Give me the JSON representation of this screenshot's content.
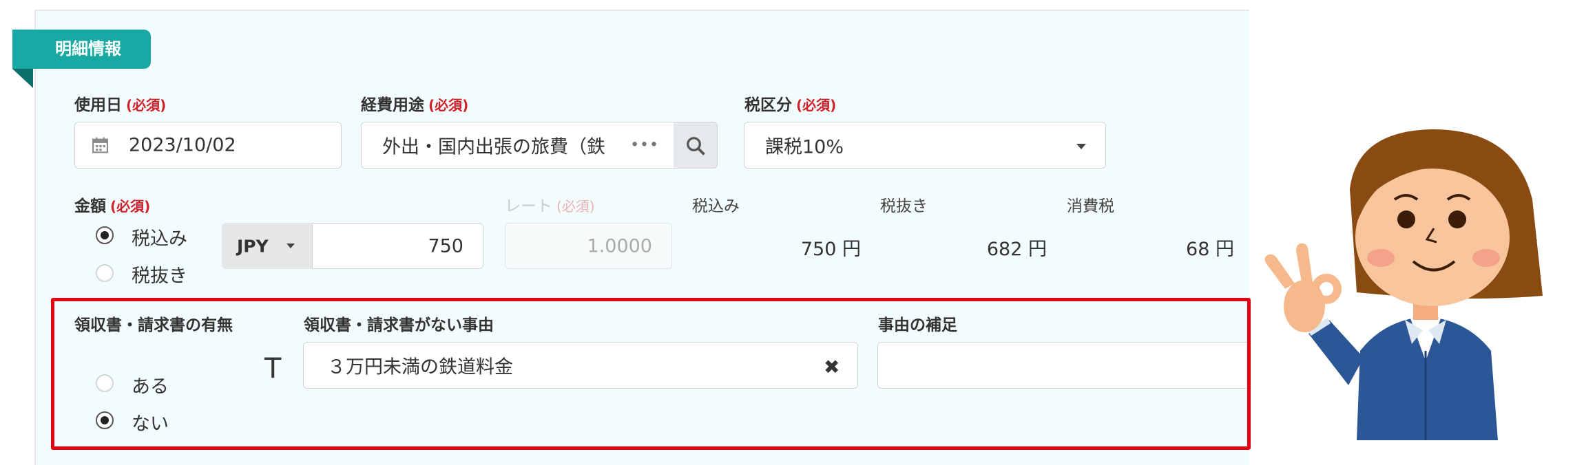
{
  "section": {
    "title": "明細情報"
  },
  "fields": {
    "date": {
      "label": "使用日",
      "required": "(必須)",
      "value": "2023/10/02"
    },
    "purpose": {
      "label": "経費用途",
      "required": "(必須)",
      "value": "外出・国内出張の旅費（鉄"
    },
    "tax_category": {
      "label": "税区分",
      "required": "(必須)",
      "value": "課税10%"
    },
    "amount": {
      "label": "金額",
      "required": "(必須)",
      "options": [
        "税込み",
        "税抜き"
      ],
      "selected": "税込み",
      "currency": "JPY",
      "value": "750"
    },
    "rate": {
      "label": "レート",
      "required": "(必須)",
      "value": "1.0000"
    },
    "summary": {
      "tax_included": {
        "label": "税込み",
        "value": "750",
        "unit": "円"
      },
      "tax_excluded": {
        "label": "税抜き",
        "value": "682",
        "unit": "円"
      },
      "consumption_tax": {
        "label": "消費税",
        "value": "68",
        "unit": "円"
      }
    },
    "receipt": {
      "label": "領収書・請求書の有無",
      "options": [
        "ある",
        "ない"
      ],
      "selected": "ない"
    },
    "no_receipt_reason": {
      "label": "領収書・請求書がない事由",
      "value": "３万円未満の鉄道料金"
    },
    "reason_note": {
      "label": "事由の補足",
      "value": ""
    }
  },
  "colors": {
    "accent": "#19a9a4",
    "highlight": "#e3000f",
    "required": "#d0202a"
  }
}
